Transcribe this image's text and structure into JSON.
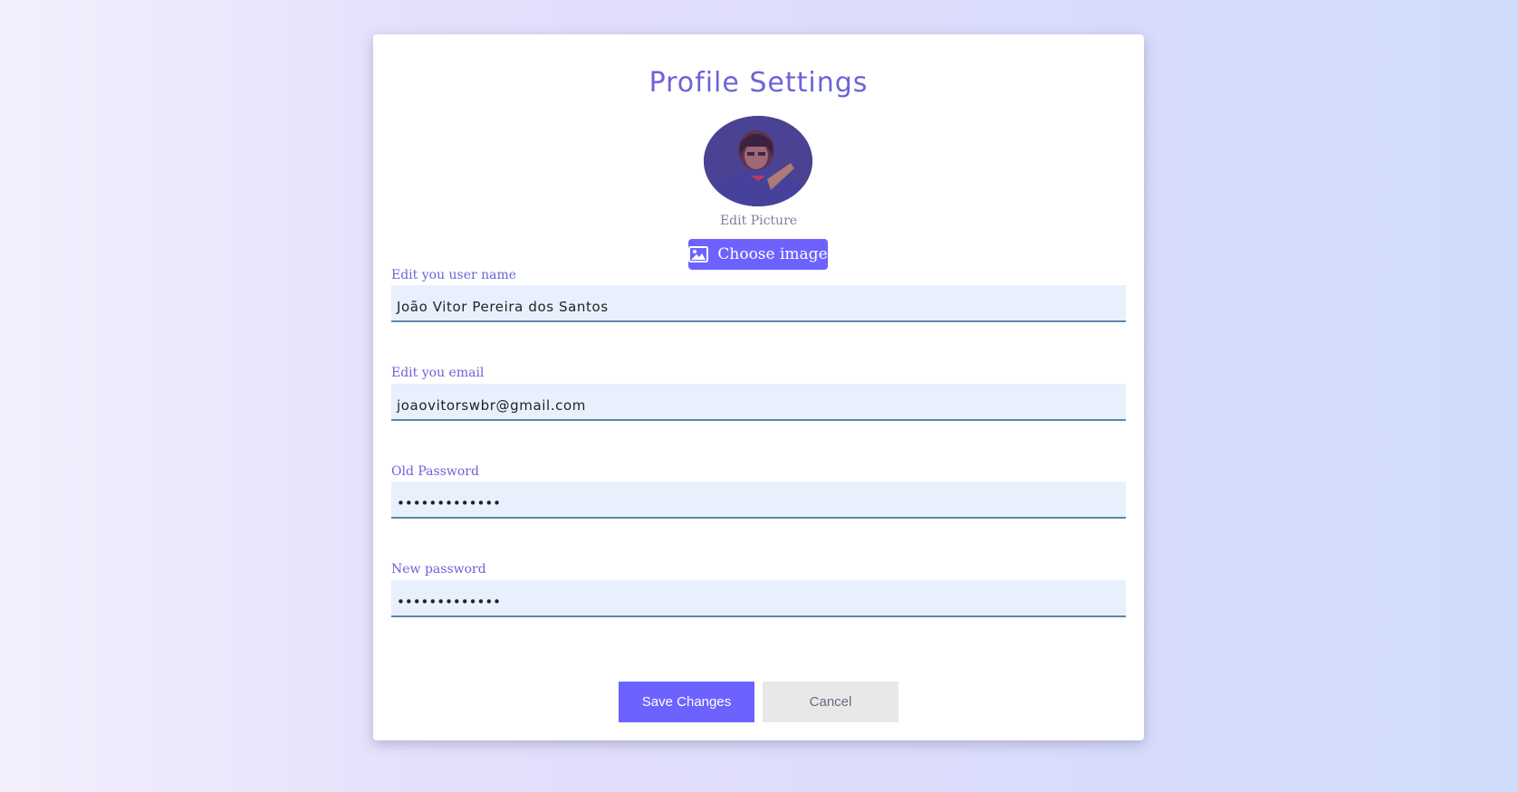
{
  "page": {
    "title": "Profile Settings"
  },
  "avatar": {
    "edit_label": "Edit Picture",
    "choose_label": "Choose image",
    "icon": "image-icon"
  },
  "fields": {
    "username": {
      "label": "Edit you user name",
      "value": "João Vitor Pereira dos Santos"
    },
    "email": {
      "label": "Edit you email",
      "value": "joaovitorswbr@gmail.com"
    },
    "old_password": {
      "label": "Old Password",
      "value": "•••••••••••••"
    },
    "new_password": {
      "label": "New password",
      "value": "•••••••••••••"
    }
  },
  "actions": {
    "save_label": "Save Changes",
    "cancel_label": "Cancel"
  },
  "colors": {
    "accent": "#6c63ff",
    "title": "#6c63d9",
    "input_bg": "#e8f0fe",
    "input_border": "#5c86a8",
    "cancel_bg": "#e8e8e8"
  }
}
